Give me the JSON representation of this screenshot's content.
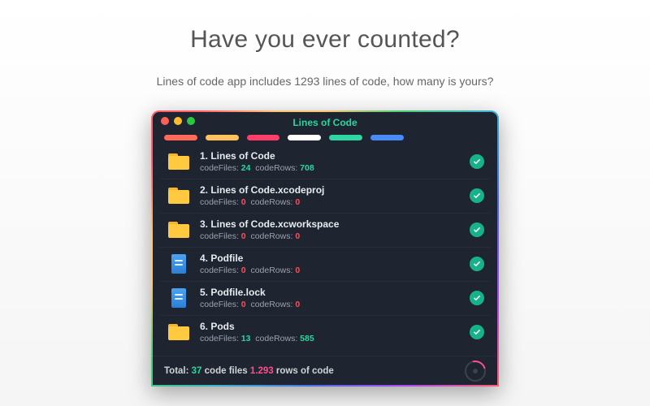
{
  "page": {
    "headline": "Have you ever counted?",
    "subheadline": "Lines of code app includes 1293 lines of code, how many is yours?"
  },
  "window": {
    "title": "Lines of Code",
    "pills": [
      "#ff6a5b",
      "#ffc25c",
      "#ff3e6c",
      "#ffffff",
      "#2fd6a2",
      "#4a8af4",
      "#1e2430",
      "#1e2430"
    ]
  },
  "items": [
    {
      "index": "1.",
      "name": "Lines of Code",
      "icon": "folder",
      "files": "24",
      "rows": "708",
      "color": "green"
    },
    {
      "index": "2.",
      "name": "Lines of Code.xcodeproj",
      "icon": "folder",
      "files": "0",
      "rows": "0",
      "color": "red"
    },
    {
      "index": "3.",
      "name": "Lines of Code.xcworkspace",
      "icon": "folder",
      "files": "0",
      "rows": "0",
      "color": "red"
    },
    {
      "index": "4.",
      "name": "Podfile",
      "icon": "file",
      "files": "0",
      "rows": "0",
      "color": "red"
    },
    {
      "index": "5.",
      "name": "Podfile.lock",
      "icon": "file",
      "files": "0",
      "rows": "0",
      "color": "red"
    },
    {
      "index": "6.",
      "name": "Pods",
      "icon": "folder",
      "files": "13",
      "rows": "585",
      "color": "green"
    }
  ],
  "labels": {
    "codeFiles": "codeFiles:",
    "codeRows": "codeRows:"
  },
  "footer": {
    "total_label": "Total:",
    "files_value": "37",
    "files_unit": "code files",
    "rows_value": "1.293",
    "rows_unit": "rows of code"
  }
}
